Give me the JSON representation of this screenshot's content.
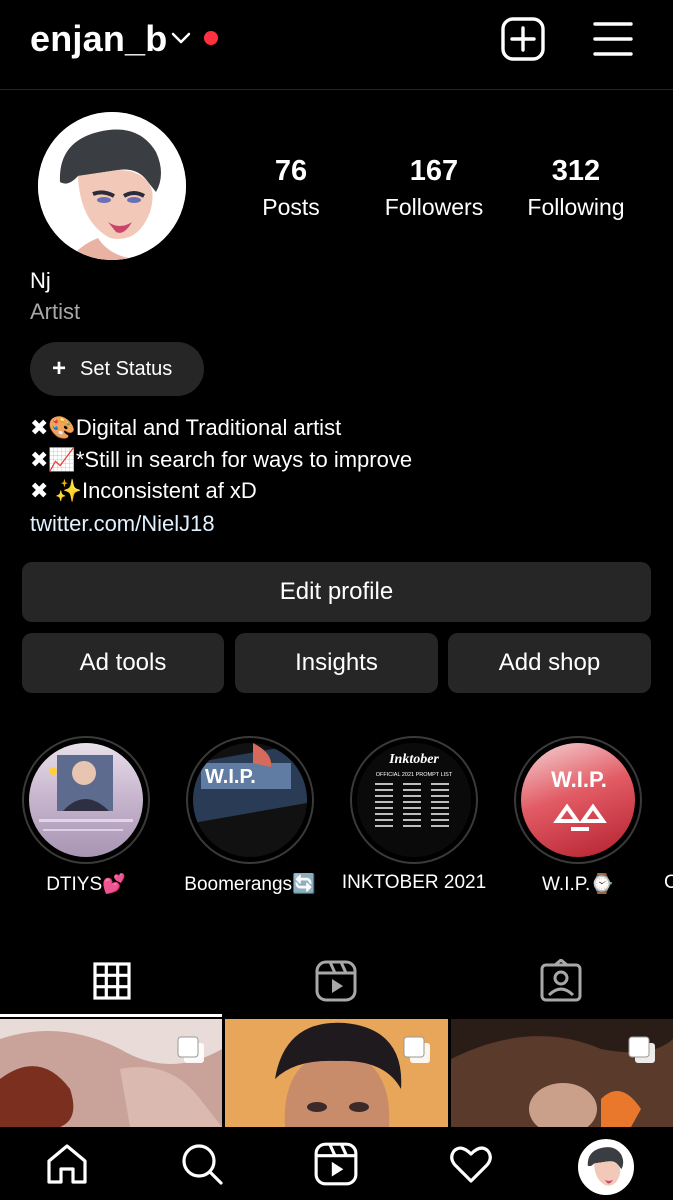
{
  "header": {
    "username": "enjan_b"
  },
  "profile": {
    "stats": [
      {
        "value": "76",
        "label": "Posts"
      },
      {
        "value": "167",
        "label": "Followers"
      },
      {
        "value": "312",
        "label": "Following"
      }
    ],
    "name": "Nj",
    "category": "Artist",
    "set_status_label": "Set Status",
    "bio": [
      {
        "emoji": "✖🎨",
        "text": "Digital and Traditional artist"
      },
      {
        "emoji": "✖📈",
        "text": "*Still in search for ways to improve"
      },
      {
        "emoji": "✖ ✨",
        "text": "Inconsistent af xD"
      }
    ],
    "link": "twitter.com/NielJ18"
  },
  "buttons": {
    "edit_profile": "Edit profile",
    "ad_tools": "Ad tools",
    "insights": "Insights",
    "add_shop": "Add shop"
  },
  "highlights": [
    {
      "label": "DTIYS💕"
    },
    {
      "label": "Boomerangs🔄"
    },
    {
      "label": "INKTOBER 2021"
    },
    {
      "label": "W.I.P.⌚"
    },
    {
      "label": "C"
    }
  ],
  "highlight_text": {
    "wip": "W.I.P.",
    "inktober_title": "Inktober",
    "inktober_subtitle": "OFFICIAL 2021 PROMPT LIST"
  },
  "tabs": [
    {
      "name": "grid",
      "icon": "grid-icon",
      "active": true
    },
    {
      "name": "reels",
      "icon": "reels-icon",
      "active": false
    },
    {
      "name": "tagged",
      "icon": "tagged-icon",
      "active": false
    }
  ],
  "colors": {
    "background": "#000000",
    "button": "#262626",
    "notification_dot": "#ff3040",
    "secondary_text": "#a8a8a8",
    "link": "#e0f1ff"
  }
}
